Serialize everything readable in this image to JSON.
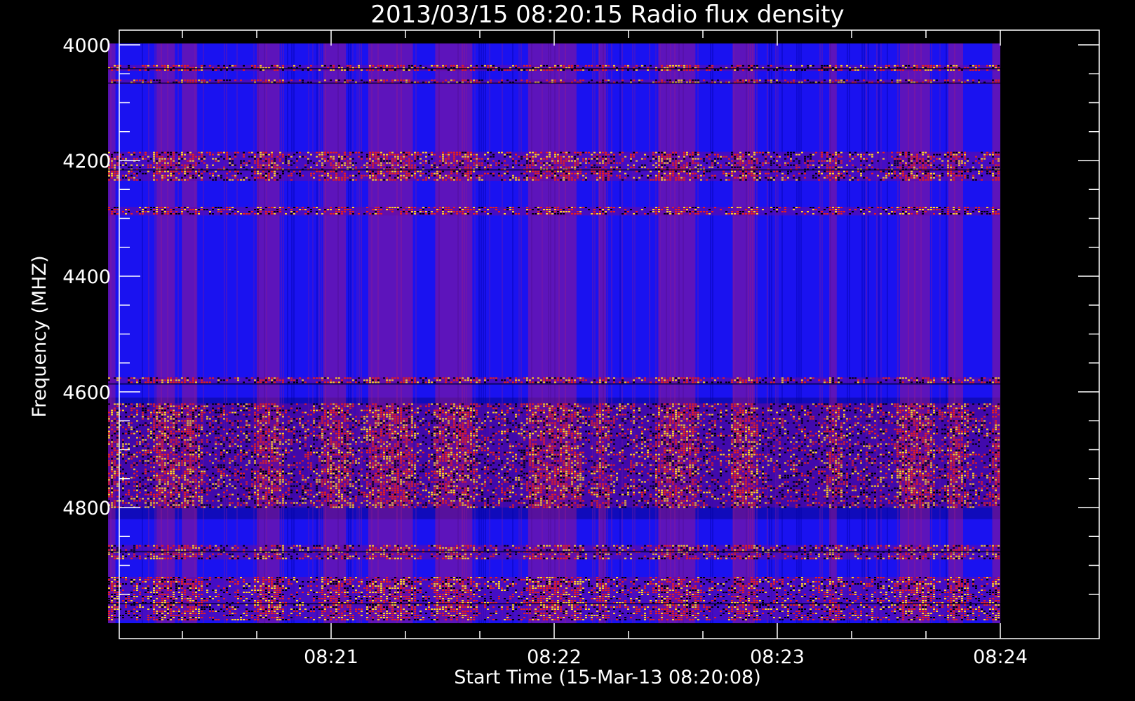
{
  "chart_data": {
    "type": "heatmap",
    "title": "2013/03/15 08:20:15 Radio flux density",
    "xlabel": "Start Time (15-Mar-13 08:20:08)",
    "ylabel": "Frequency (MHZ)",
    "x_tick_labels": [
      "08:21",
      "08:22",
      "08:23",
      "08:24"
    ],
    "x_tick_seconds": [
      52,
      112,
      172,
      232
    ],
    "x_range_seconds": [
      -20,
      244
    ],
    "x_data_range_seconds": [
      -8,
      232
    ],
    "y_tick_labels": [
      "4000",
      "4200",
      "4400",
      "4600",
      "4800"
    ],
    "y_tick_values": [
      4000,
      4200,
      4400,
      4600,
      4800
    ],
    "y_range": [
      4000,
      5000
    ],
    "y_reversed": true,
    "colormap": [
      "#000000",
      "#0000ff",
      "#ff0000",
      "#ffff00"
    ],
    "colormap_description": "black-blue-red-yellow (low to high)",
    "background_level": "blue",
    "bright_frequency_bands_mhz": [
      [
        4035,
        4045
      ],
      [
        4060,
        4068
      ],
      [
        4185,
        4235
      ],
      [
        4280,
        4295
      ],
      [
        4575,
        4585
      ],
      [
        4620,
        4800
      ],
      [
        4865,
        4890
      ],
      [
        4920,
        4995
      ]
    ],
    "bright_time_columns_seconds": [
      [
        -8,
        -6
      ],
      [
        5,
        10
      ],
      [
        12,
        16
      ],
      [
        32,
        38
      ],
      [
        50,
        56
      ],
      [
        62,
        70
      ],
      [
        70,
        74
      ],
      [
        80,
        90
      ],
      [
        105,
        118
      ],
      [
        124,
        126
      ],
      [
        140,
        150
      ],
      [
        160,
        166
      ],
      [
        186,
        188
      ],
      [
        205,
        213
      ],
      [
        218,
        222
      ],
      [
        230,
        232
      ]
    ]
  }
}
